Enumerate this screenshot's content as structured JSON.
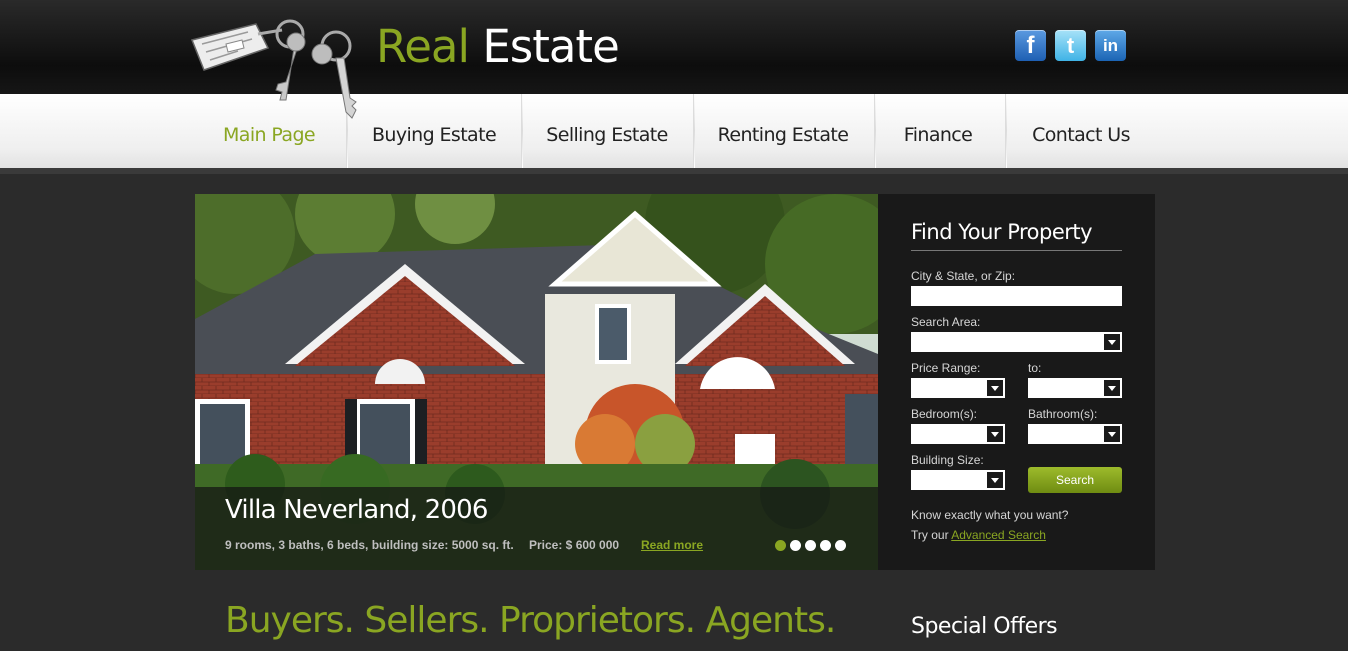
{
  "header": {
    "logo_part1": "Real",
    "logo_part2": "Estate",
    "social": [
      {
        "icon": "facebook-icon",
        "glyph": "f"
      },
      {
        "icon": "twitter-icon",
        "glyph": "t"
      },
      {
        "icon": "linkedin-icon",
        "glyph": "in"
      }
    ]
  },
  "nav": {
    "items": [
      {
        "label": "Main Page",
        "active": true
      },
      {
        "label": "Buying Estate"
      },
      {
        "label": "Selling Estate"
      },
      {
        "label": "Renting Estate"
      },
      {
        "label": "Finance"
      },
      {
        "label": "Contact Us"
      }
    ]
  },
  "slider": {
    "title": "Villa Neverland, 2006",
    "details": "9 rooms, 3 baths, 6 beds, building size: 5000 sq. ft.",
    "price": "Price: $ 600 000",
    "read_more": "Read more",
    "slide_count": 5,
    "active_slide": 1
  },
  "search": {
    "title": "Find Your Property",
    "city_label": "City & State, or Zip:",
    "city_value": "",
    "area_label": "Search Area:",
    "price_label": "Price Range:",
    "to_label": "to:",
    "bedrooms_label": "Bedroom(s):",
    "bathrooms_label": "Bathroom(s):",
    "building_label": "Building Size:",
    "button": "Search",
    "note1": "Know exactly what you want?",
    "note2_prefix": "Try our",
    "note2_link": "Advanced Search"
  },
  "main": {
    "tagline": "Buyers. Sellers. Proprietors. Agents.",
    "sidebar_title": "Special Offers"
  },
  "colors": {
    "accent": "#8aa622",
    "background": "#2b2b2b",
    "panel": "#191919"
  }
}
